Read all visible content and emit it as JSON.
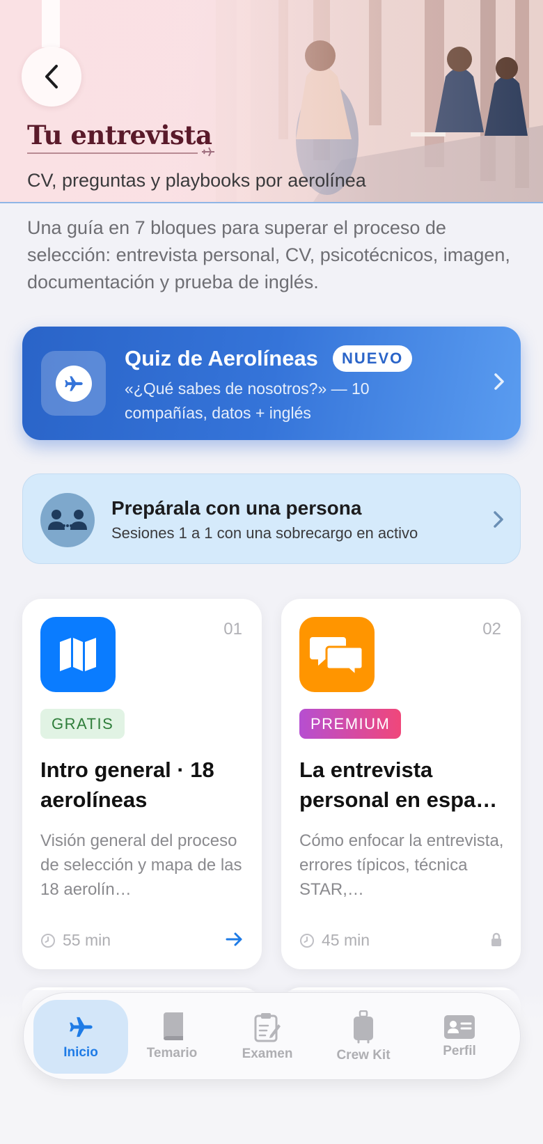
{
  "header": {
    "title": "Tu entrevista",
    "subtitle": "CV, preguntas y playbooks por aerolínea"
  },
  "intro": "Una guía en 7 bloques para superar el proceso de selección: entrevista personal, CV, psicotécnicos, imagen, documentación y prueba de inglés.",
  "quiz_card": {
    "title": "Quiz de Aerolíneas",
    "badge": "NUEVO",
    "subtitle": "«¿Qué sabes de nosotros?» — 10 compañías, datos + inglés"
  },
  "coach_card": {
    "title": "Prepárala con una persona",
    "subtitle": "Sesiones 1 a 1 con una sobrecargo en activo"
  },
  "modules": [
    {
      "number": "01",
      "badge": "GRATIS",
      "title": "Intro general · 18 aerolíneas",
      "description": "Visión general del proceso de selección y mapa de las 18 aerolín…",
      "duration": "55 min",
      "icon": "map-icon",
      "icon_color": "#0a7cff",
      "locked": false
    },
    {
      "number": "02",
      "badge": "PREMIUM",
      "title": "La entrevista personal en espa…",
      "description": "Cómo enfocar la entrevista, errores típicos, técnica STAR,…",
      "duration": "45 min",
      "icon": "chat-bubbles-icon",
      "icon_color": "#ff9500",
      "locked": true
    }
  ],
  "tabbar": {
    "items": [
      {
        "label": "Inicio",
        "icon": "airplane-icon",
        "active": true
      },
      {
        "label": "Temario",
        "icon": "book-icon",
        "active": false
      },
      {
        "label": "Examen",
        "icon": "clipboard-icon",
        "active": false
      },
      {
        "label": "Crew Kit",
        "icon": "suitcase-icon",
        "active": false
      },
      {
        "label": "Perfil",
        "icon": "id-card-icon",
        "active": false
      }
    ]
  },
  "colors": {
    "accent": "#1e7be6",
    "title_burgundy": "#5a1a2a",
    "quiz_blue": "#2a64c8"
  }
}
